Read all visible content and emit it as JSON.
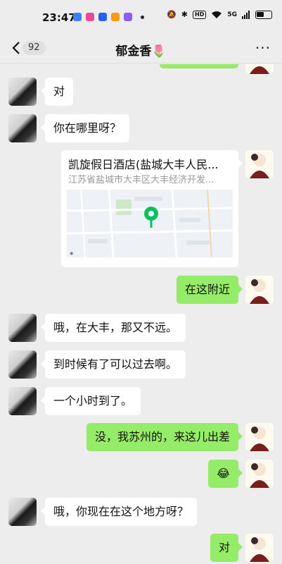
{
  "status_bar": {
    "time": "23:47",
    "network": "5G"
  },
  "header": {
    "unread_count": "92",
    "title": "郁金香🌷"
  },
  "messages": [
    {
      "side": "in",
      "text": "对"
    },
    {
      "side": "in",
      "text": "你在哪里呀？"
    },
    {
      "side": "out",
      "type": "location",
      "name": "凯旋假日酒店(盐城大丰人民...",
      "address": "江苏省盐城市大丰区大丰经济开发..."
    },
    {
      "side": "out",
      "text": "在这附近"
    },
    {
      "side": "in",
      "text": "哦，在大丰，那又不远。"
    },
    {
      "side": "in",
      "text": "到时候有了可以过去啊。"
    },
    {
      "side": "in",
      "text": "一个小时到了。"
    },
    {
      "side": "out",
      "text": "没，我苏州的，来这儿出差"
    },
    {
      "side": "out",
      "text": "😂"
    },
    {
      "side": "in",
      "text": "哦，你现在在这个地方呀？"
    },
    {
      "side": "out",
      "text": "对"
    }
  ],
  "colors": {
    "outgoing_bubble": "#95ec69",
    "incoming_bubble": "#ffffff",
    "background": "#ededed",
    "map_pin": "#07c160"
  }
}
